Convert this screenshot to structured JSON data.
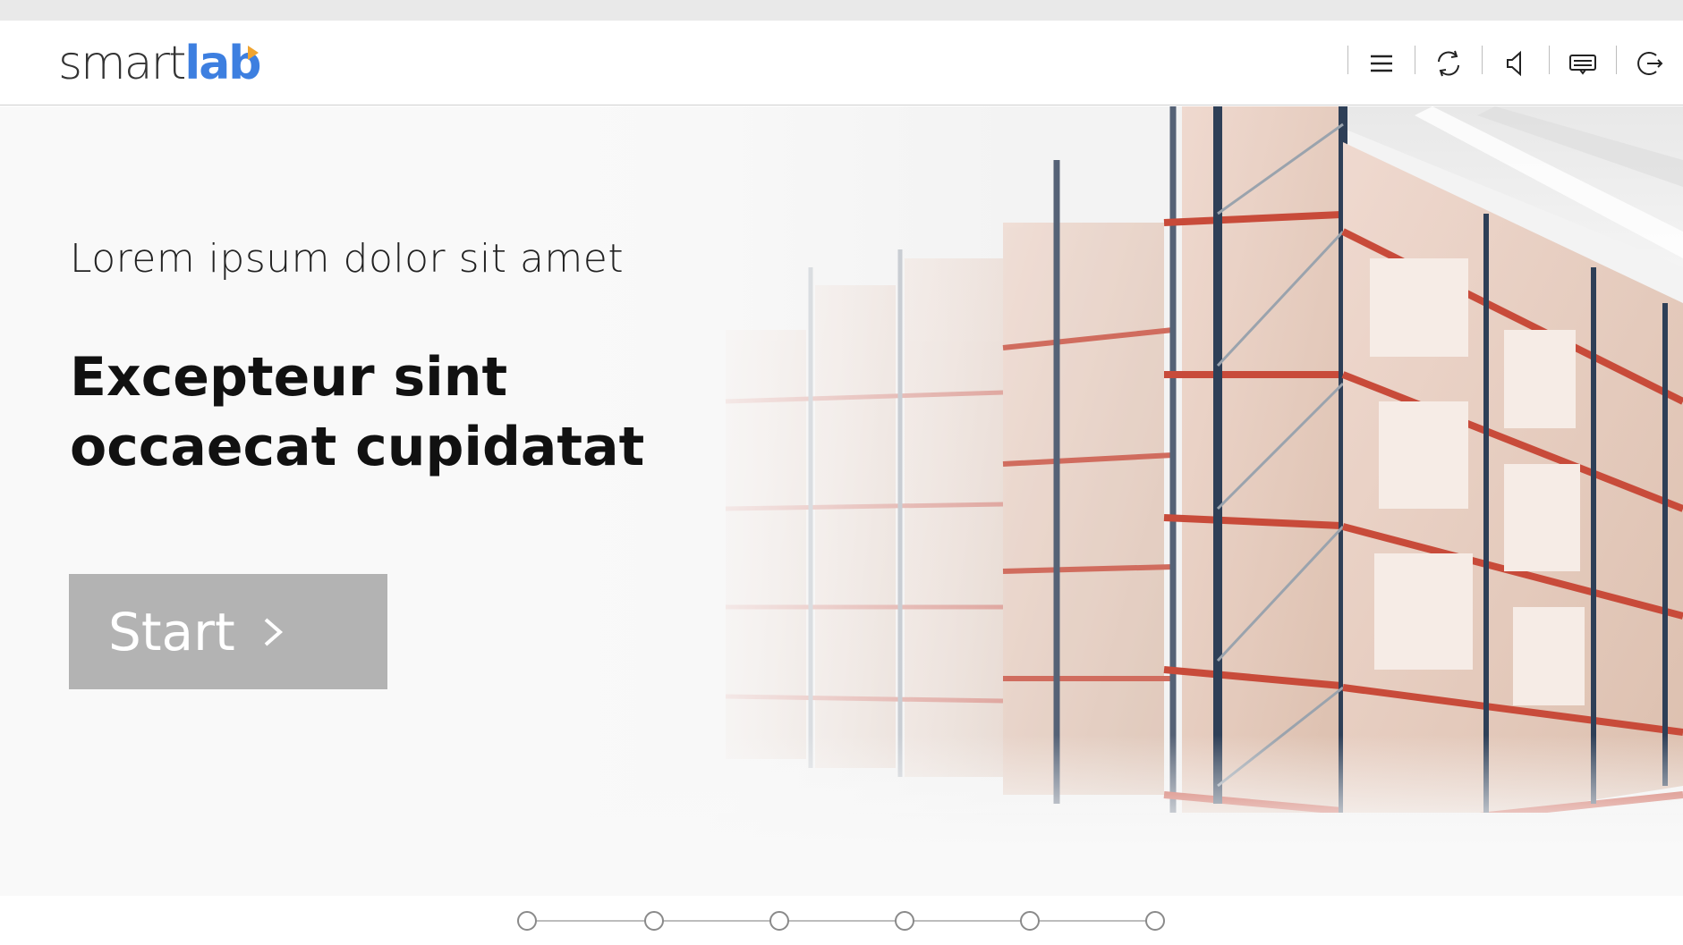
{
  "logo": {
    "part1": "smart",
    "part2": "lab"
  },
  "toolbar": {
    "items": [
      {
        "name": "menu",
        "icon": "hamburger-menu-icon"
      },
      {
        "name": "restart",
        "icon": "refresh-icon"
      },
      {
        "name": "audio",
        "icon": "speaker-icon"
      },
      {
        "name": "captions",
        "icon": "captions-icon"
      },
      {
        "name": "exit",
        "icon": "exit-icon"
      }
    ]
  },
  "hero": {
    "subtitle": "Lorem ipsum dolor sit amet",
    "title": "Excepteur sint occaecat cupidatat",
    "start_label": "Start"
  },
  "progress": {
    "steps": 6,
    "current": 1
  },
  "colors": {
    "brand_blue": "#3d7fe0",
    "brand_orange": "#f0a430",
    "start_button": "#b3b3b3",
    "rack_red": "#c84b3a",
    "rack_blue": "#2e3f57"
  }
}
